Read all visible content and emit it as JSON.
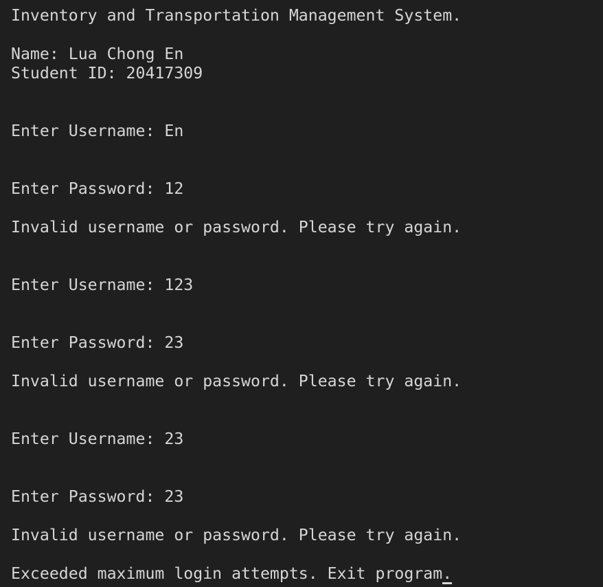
{
  "terminal": {
    "lines": [
      "Inventory and Transportation Management System.",
      "",
      "Name: Lua Chong En",
      "Student ID: 20417309",
      "",
      "",
      "Enter Username: En",
      "",
      "",
      "Enter Password: 12",
      "",
      "Invalid username or password. Please try again.",
      "",
      "",
      "Enter Username: 123",
      "",
      "",
      "Enter Password: 23",
      "",
      "Invalid username or password. Please try again.",
      "",
      "",
      "Enter Username: 23",
      "",
      "",
      "Enter Password: 23",
      "",
      "Invalid username or password. Please try again.",
      "",
      "Exceeded maximum login attempts. Exit program."
    ]
  }
}
